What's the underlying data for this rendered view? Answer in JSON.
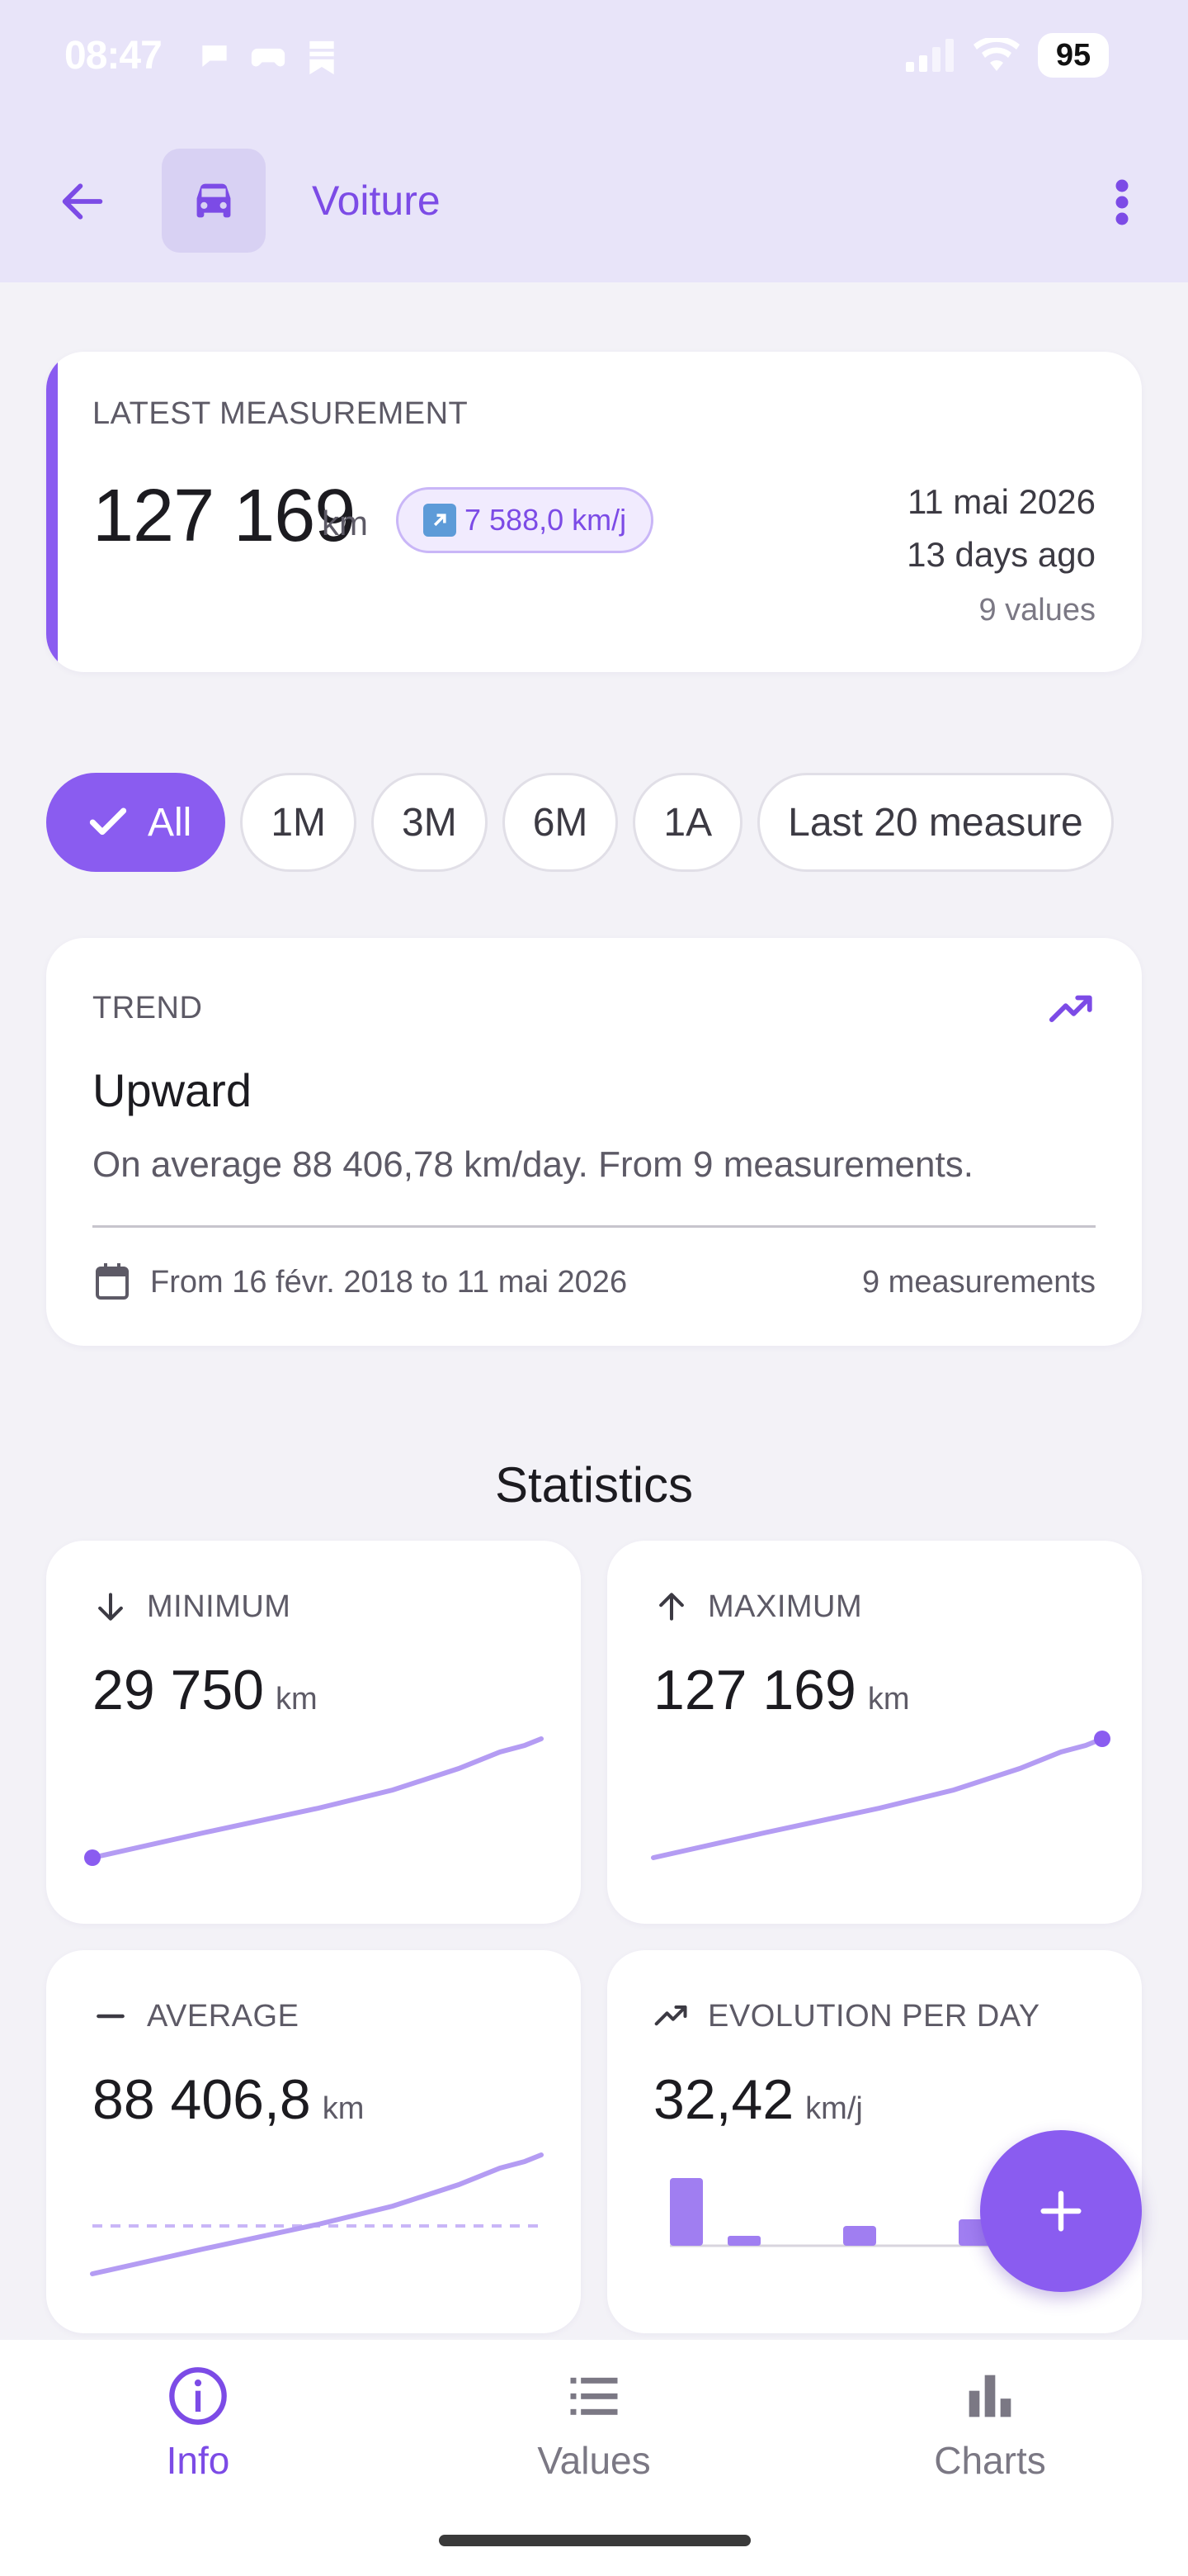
{
  "status_bar": {
    "time": "08:47",
    "battery": "95"
  },
  "app_bar": {
    "title": "Voiture",
    "icon": "car-icon"
  },
  "latest": {
    "label": "LATEST MEASUREMENT",
    "value": "127 169",
    "unit": "km",
    "rate": "7 588,0 km/j",
    "date": "11 mai 2026",
    "ago": "13 days ago",
    "count": "9 values"
  },
  "filters": [
    {
      "label": "All",
      "active": true
    },
    {
      "label": "1M"
    },
    {
      "label": "3M"
    },
    {
      "label": "6M"
    },
    {
      "label": "1A"
    },
    {
      "label": "Last 20 measure"
    }
  ],
  "trend": {
    "label": "TREND",
    "title": "Upward",
    "description": "On average 88 406,78 km/day. From 9 measurements.",
    "range": "From 16 févr. 2018 to 11 mai 2026",
    "count": "9 measurements"
  },
  "statistics": {
    "title": "Statistics",
    "minimum": {
      "label": "MINIMUM",
      "value": "29 750",
      "unit": "km"
    },
    "maximum": {
      "label": "MAXIMUM",
      "value": "127 169",
      "unit": "km"
    },
    "average": {
      "label": "AVERAGE",
      "value": "88 406,8",
      "unit": "km"
    },
    "evolution": {
      "label": "EVOLUTION PER DAY",
      "value": "32,42",
      "unit": "km/j"
    }
  },
  "bottom_nav": {
    "info": "Info",
    "values": "Values",
    "charts": "Charts"
  },
  "colors": {
    "accent": "#8a5cf0",
    "header_bg": "#e8e4f9",
    "page_bg": "#f3f2f7"
  }
}
